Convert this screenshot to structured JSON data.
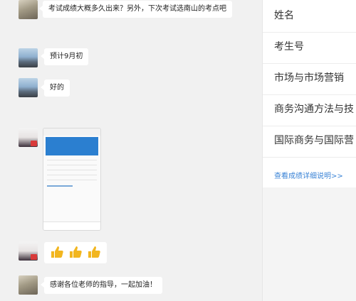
{
  "messages": [
    {
      "text": "考试成绩大概多久出来？另外，下次考试选南山的考点吧"
    },
    {
      "text": "预计9月初"
    },
    {
      "text": "好的"
    },
    {
      "text": "感谢各位老师的指导，一起加油！"
    }
  ],
  "thumbs_up": {
    "count": 3,
    "icon": "thumbs-up-icon"
  },
  "score_panel": {
    "rows": [
      "姓名",
      "考生号",
      "市场与市场营销",
      "商务沟通方法与技",
      "国际商务与国际营"
    ],
    "link": "查看成绩详细说明>>"
  },
  "colors": {
    "link": "#3a83d6",
    "thumb": "#f2b61f",
    "chat_bg": "#f1f1f1"
  }
}
